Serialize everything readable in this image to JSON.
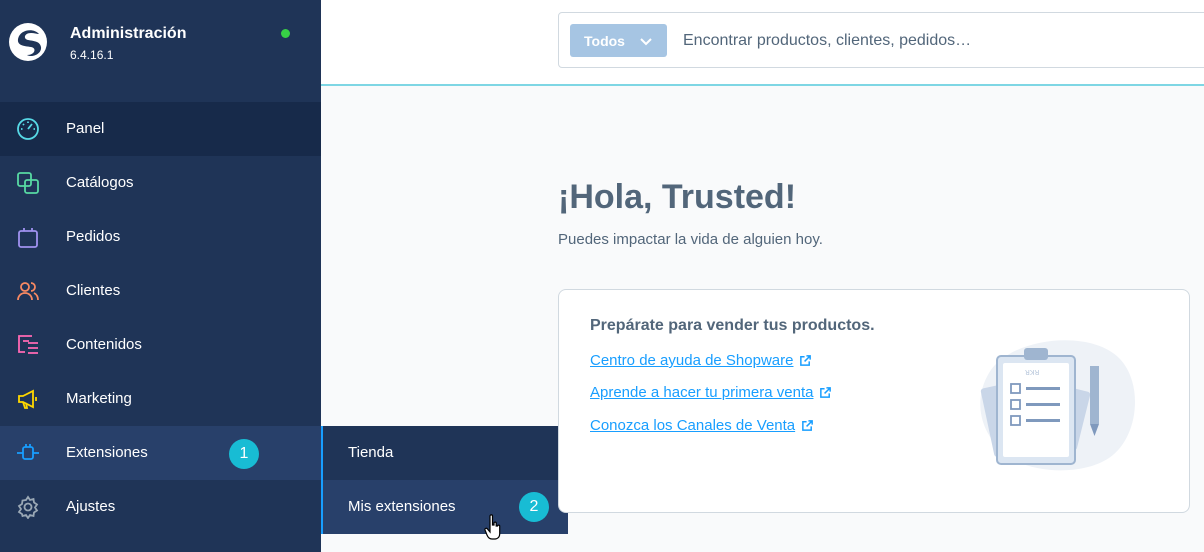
{
  "app": {
    "title": "Administración",
    "version": "6.4.16.1"
  },
  "nav": {
    "items": [
      {
        "label": "Panel",
        "icon": "gauge-icon",
        "color": "#57d9e6"
      },
      {
        "label": "Catálogos",
        "icon": "catalog-icon",
        "color": "#57d9a3"
      },
      {
        "label": "Pedidos",
        "icon": "shopping-bag-icon",
        "color": "#a092f0"
      },
      {
        "label": "Clientes",
        "icon": "users-icon",
        "color": "#f88962"
      },
      {
        "label": "Contenidos",
        "icon": "content-icon",
        "color": "#ff68b4"
      },
      {
        "label": "Marketing",
        "icon": "megaphone-icon",
        "color": "#ffd700"
      },
      {
        "label": "Extensiones",
        "icon": "plug-icon",
        "color": "#189eff"
      },
      {
        "label": "Ajustes",
        "icon": "gear-icon",
        "color": "#9aa8b5"
      }
    ]
  },
  "flyout": {
    "items": [
      {
        "label": "Tienda"
      },
      {
        "label": "Mis extensiones"
      }
    ]
  },
  "badges": {
    "one": "1",
    "two": "2"
  },
  "search": {
    "type_label": "Todos",
    "placeholder": "Encontrar productos, clientes, pedidos…"
  },
  "dashboard": {
    "greeting": "¡Hola, Trusted!",
    "subtitle": "Puedes impactar la vida de alguien hoy.",
    "card": {
      "title": "Prepárate para vender tus productos.",
      "links": [
        "Centro de ayuda de Shopware",
        "Aprende a hacer tu primera venta",
        "Conozca los Canales de Venta"
      ]
    }
  },
  "colors": {
    "sidebar": "#1f3457",
    "accent": "#189eff",
    "badge": "#18bcd4"
  }
}
